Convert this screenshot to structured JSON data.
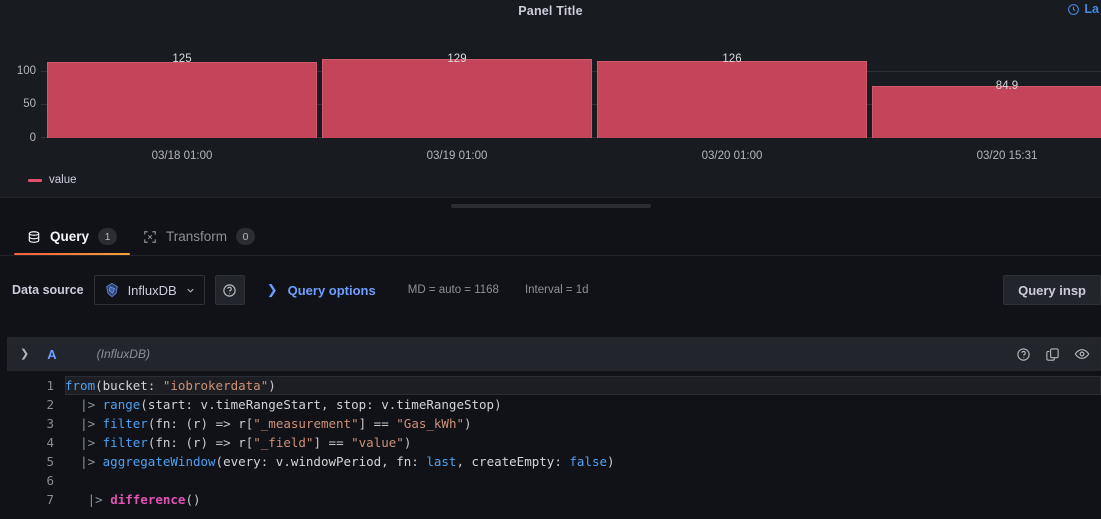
{
  "panel": {
    "title": "Panel Title",
    "time_picker_label": "La",
    "time_picker_icon": "clock-icon"
  },
  "chart_data": {
    "type": "bar",
    "title": "Panel Title",
    "categories": [
      "03/18 01:00",
      "03/19 01:00",
      "03/20 01:00",
      "03/20 15:31"
    ],
    "values": [
      125,
      129,
      126,
      84.9
    ],
    "value_labels": [
      "125",
      "129",
      "126",
      "84.9"
    ],
    "series": [
      {
        "name": "value",
        "values": [
          125,
          129,
          126,
          84.9
        ],
        "color": "#c4455a"
      }
    ],
    "xlabel": "",
    "ylabel": "",
    "ylim": [
      0,
      140
    ],
    "yticks": [
      0,
      50,
      100
    ],
    "ytick_labels": [
      "0",
      "50",
      "100"
    ],
    "grid": true,
    "legend": {
      "position": "bottom",
      "entries": [
        "value"
      ]
    }
  },
  "legend": {
    "label": "value"
  },
  "tabs": [
    {
      "label": "Query",
      "count": "1",
      "icon": "database-icon",
      "active": true
    },
    {
      "label": "Transform",
      "count": "0",
      "icon": "transform-icon",
      "active": false
    }
  ],
  "datasource_row": {
    "label": "Data source",
    "selected": "InfluxDB",
    "datasource_icon": "influxdb-icon",
    "dropdown_icon": "chevron-down-icon",
    "help_icon": "question-circle-icon",
    "query_options_label": "Query options",
    "query_options_chevron": "chevron-right-icon",
    "max_data_points": "MD = auto = 1168",
    "interval": "Interval = 1d",
    "query_inspector_label": "Query insp"
  },
  "query": {
    "ref_id": "A",
    "datasource_name": "(InfluxDB)",
    "collapse_icon": "chevron-down-icon",
    "actions": [
      {
        "name": "help-icon"
      },
      {
        "name": "duplicate-icon"
      },
      {
        "name": "toggle-visibility-icon"
      }
    ],
    "code_lines": [
      {
        "n": "1",
        "text": "from(bucket: \"iobrokerdata\")"
      },
      {
        "n": "2",
        "text": "  |> range(start: v.timeRangeStart, stop: v.timeRangeStop)"
      },
      {
        "n": "3",
        "text": "  |> filter(fn: (r) => r[\"_measurement\"] == \"Gas_kWh\")"
      },
      {
        "n": "4",
        "text": "  |> filter(fn: (r) => r[\"_field\"] == \"value\")"
      },
      {
        "n": "5",
        "text": "  |> aggregateWindow(every: v.windowPeriod, fn: last, createEmpty: false)"
      },
      {
        "n": "6",
        "text": ""
      },
      {
        "n": "7",
        "text": "   |> difference()"
      }
    ]
  }
}
